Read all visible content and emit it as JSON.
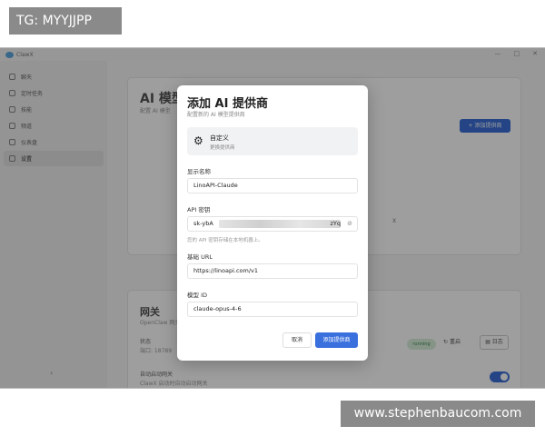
{
  "watermarks": {
    "top": "TG: MYYJJPP",
    "bottom": "www.stephenbaucom.com"
  },
  "app": {
    "title": "ClawX",
    "window_controls": [
      "—",
      "□",
      "✕"
    ]
  },
  "sidebar": {
    "items": [
      {
        "label": "聊天",
        "icon": "chat-icon"
      },
      {
        "label": "定时任务",
        "icon": "clock-icon"
      },
      {
        "label": "技能",
        "icon": "puzzle-icon"
      },
      {
        "label": "频道",
        "icon": "channel-icon"
      },
      {
        "label": "仪表盘",
        "icon": "home-icon"
      },
      {
        "label": "设置",
        "icon": "gear-icon"
      }
    ],
    "collapse": "‹"
  },
  "background": {
    "ai_title": "AI 模型",
    "ai_sub": "配置 AI 模型",
    "add_provider": "+ 添加提供商",
    "x_fragment": "X",
    "gateway_title": "网关",
    "gateway_sub": "OpenClaw 网关",
    "status_label": "状态",
    "port_label": "端口: 18789",
    "running": "running",
    "restart": "重启",
    "logs": "日志",
    "auto_label": "自动启动网关",
    "auto_sub": "ClawX 启动时自动启动网关"
  },
  "modal": {
    "title": "添加 AI 提供商",
    "subtitle": "配置新的 AI 模型提供商",
    "provider": {
      "name": "自定义",
      "change": "更换提供商"
    },
    "fields": {
      "display_name": {
        "label": "显示名称",
        "value": "LinoAPI-Claude"
      },
      "api_key": {
        "label": "API 密钥",
        "prefix": "sk-ybA",
        "suffix": "zYq",
        "hint": "您的 API 密钥存储在本地机器上。"
      },
      "base_url": {
        "label": "基础 URL",
        "value": "https://linoapi.com/v1"
      },
      "model_id": {
        "label": "模型 ID",
        "value": "claude-opus-4-6"
      }
    },
    "cancel": "取消",
    "submit": "添加提供商"
  }
}
